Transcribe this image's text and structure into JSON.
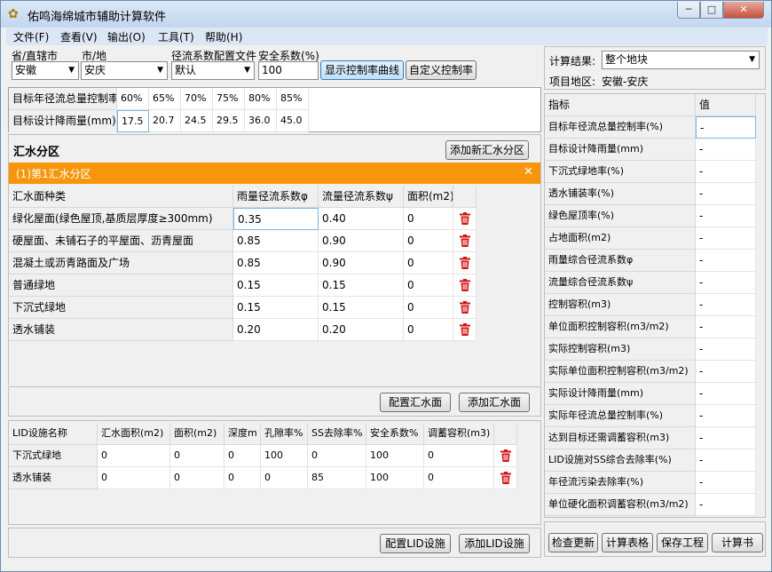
{
  "app": {
    "title": "佑鸣海绵城市辅助计算软件",
    "window_controls": {
      "minimize": "─",
      "maximize": "□",
      "close": "✕"
    }
  },
  "menu": [
    "文件(F)",
    "查看(V)",
    "输出(O)",
    "工具(T)",
    "帮助(H)"
  ],
  "location": {
    "province_label": "省/直辖市",
    "province_value": "安徽",
    "city_label": "市/地",
    "city_value": "安庆",
    "runoff_config_label": "径流系数配置文件",
    "runoff_config_value": "默认",
    "safety_label": "安全系数(%)",
    "safety_value": "100",
    "show_curve_button": "显示控制率曲线",
    "custom_rate_button": "自定义控制率"
  },
  "targets": {
    "rate_label": "目标年径流总量控制率",
    "rates": [
      "60%",
      "65%",
      "70%",
      "75%",
      "80%",
      "85%"
    ],
    "rain_label": "目标设计降雨量(mm)",
    "rains": [
      "17.5",
      "20.7",
      "24.5",
      "29.5",
      "36.0",
      "45.0"
    ]
  },
  "catchment": {
    "section_title": "汇水分区",
    "add_zone_button": "添加新汇水分区",
    "zone_title": "(1)第1汇水分区",
    "close_icon": "✕",
    "columns": [
      "汇水面种类",
      "雨量径流系数φ",
      "流量径流系数ψ",
      "面积(m2)"
    ],
    "rows": [
      {
        "name": "绿化屋面(绿色屋顶,基质层厚度≥300mm)",
        "rain": "0.35",
        "flow": "0.40",
        "area": "0"
      },
      {
        "name": "硬屋面、未铺石子的平屋面、沥青屋面",
        "rain": "0.85",
        "flow": "0.90",
        "area": "0"
      },
      {
        "name": "混凝土或沥青路面及广场",
        "rain": "0.85",
        "flow": "0.90",
        "area": "0"
      },
      {
        "name": "普通绿地",
        "rain": "0.15",
        "flow": "0.15",
        "area": "0"
      },
      {
        "name": "下沉式绿地",
        "rain": "0.15",
        "flow": "0.15",
        "area": "0"
      },
      {
        "name": "透水铺装",
        "rain": "0.20",
        "flow": "0.20",
        "area": "0"
      }
    ],
    "config_button": "配置汇水面",
    "add_button": "添加汇水面"
  },
  "lid": {
    "columns": [
      "LID设施名称",
      "汇水面积(m2)",
      "面积(m2)",
      "深度m",
      "孔隙率%",
      "SS去除率%",
      "安全系数%",
      "调蓄容积(m3)"
    ],
    "rows": [
      {
        "name": "下沉式绿地",
        "catch": "0",
        "area": "0",
        "depth": "0",
        "porosity": "100",
        "ss": "0",
        "safety": "100",
        "volume": "0"
      },
      {
        "name": "透水铺装",
        "catch": "0",
        "area": "0",
        "depth": "0",
        "porosity": "0",
        "ss": "85",
        "safety": "100",
        "volume": "0"
      }
    ],
    "config_button": "配置LID设施",
    "add_button": "添加LID设施"
  },
  "results": {
    "label": "计算结果:",
    "scope_value": "整个地块",
    "project_label": "项目地区:",
    "project_value": "安徽-安庆",
    "columns": [
      "指标",
      "值"
    ],
    "rows": [
      {
        "name": "目标年径流总量控制率(%)",
        "value": "-"
      },
      {
        "name": "目标设计降雨量(mm)",
        "value": "-"
      },
      {
        "name": "下沉式绿地率(%)",
        "value": "-"
      },
      {
        "name": "透水铺装率(%)",
        "value": "-"
      },
      {
        "name": "绿色屋顶率(%)",
        "value": "-"
      },
      {
        "name": "占地面积(m2)",
        "value": "-"
      },
      {
        "name": "雨量综合径流系数φ",
        "value": "-"
      },
      {
        "name": "流量综合径流系数ψ",
        "value": "-"
      },
      {
        "name": "控制容积(m3)",
        "value": "-"
      },
      {
        "name": "单位面积控制容积(m3/m2)",
        "value": "-"
      },
      {
        "name": "实际控制容积(m3)",
        "value": "-"
      },
      {
        "name": "实际单位面积控制容积(m3/m2)",
        "value": "-"
      },
      {
        "name": "实际设计降雨量(mm)",
        "value": "-"
      },
      {
        "name": "实际年径流总量控制率(%)",
        "value": "-"
      },
      {
        "name": "达到目标还需调蓄容积(m3)",
        "value": "-"
      },
      {
        "name": "LID设施对SS综合去除率(%)",
        "value": "-"
      },
      {
        "name": "年径流污染去除率(%)",
        "value": "-"
      },
      {
        "name": "单位硬化面积调蓄容积(m3/m2)",
        "value": "-"
      }
    ],
    "buttons": [
      "检查更新",
      "计算表格",
      "保存工程",
      "计算书"
    ]
  }
}
